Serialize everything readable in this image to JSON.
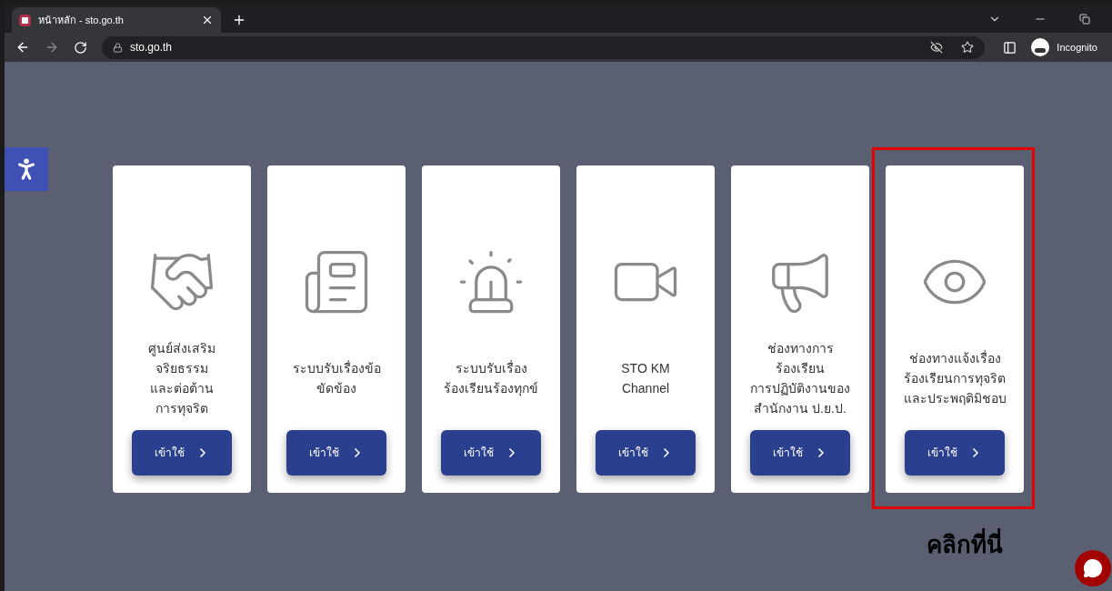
{
  "browser": {
    "tab_title": "หน้าหลัก - sto.go.th",
    "url": "sto.go.th",
    "profile": "Incognito"
  },
  "cards": [
    {
      "kind": "handshake",
      "title_lines": [
        "ศูนย์ส่งเสริม",
        "จริยธรรม",
        "และต่อต้าน",
        "การทุจริต"
      ],
      "button": "เข้าใช้",
      "highlighted": false
    },
    {
      "kind": "newspaper",
      "title_lines": [
        "ระบบรับเรื่องข้อ",
        "ขัดข้อง"
      ],
      "button": "เข้าใช้",
      "highlighted": false
    },
    {
      "kind": "siren",
      "title_lines": [
        "ระบบรับเรื่อง",
        "ร้องเรียนร้องทุกข์"
      ],
      "button": "เข้าใช้",
      "highlighted": false
    },
    {
      "kind": "camera",
      "title_lines": [
        "STO KM",
        "Channel"
      ],
      "button": "เข้าใช้",
      "highlighted": false
    },
    {
      "kind": "megaphone",
      "title_lines": [
        "ช่องทางการ",
        "ร้องเรียน",
        "การปฏิบัติงานของ",
        "สำนักงาน ป.ย.ป."
      ],
      "button": "เข้าใช้",
      "highlighted": false
    },
    {
      "kind": "eye",
      "title_lines": [
        "ช่องทางแจ้งเรื่อง",
        "ร้องเรียนการทุจริต",
        "และประพฤติมิชอบ"
      ],
      "button": "เข้าใช้",
      "highlighted": true
    }
  ],
  "callout": "คลิกที่นี่"
}
